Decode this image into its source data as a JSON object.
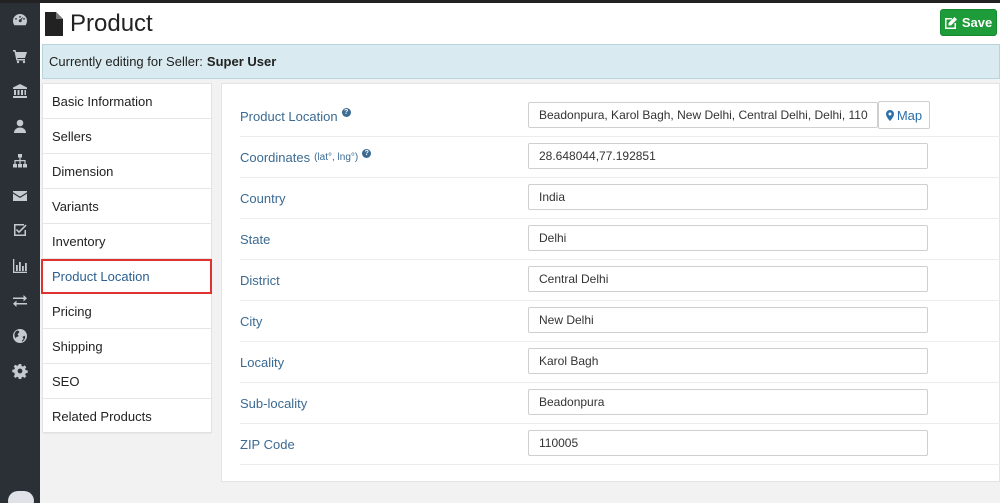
{
  "header": {
    "title": "Product",
    "save_label": "Save"
  },
  "seller_bar": {
    "prefix": "Currently editing for Seller:",
    "seller_name": "Super User"
  },
  "sidebar_icons": [
    "dashboard-icon",
    "cart-icon",
    "bank-icon",
    "user-icon",
    "sitemap-icon",
    "envelope-icon",
    "checkbox-icon",
    "bar-chart-icon",
    "exchange-icon",
    "globe-icon",
    "cog-icon"
  ],
  "tabs": [
    {
      "label": "Basic Information"
    },
    {
      "label": "Sellers"
    },
    {
      "label": "Dimension"
    },
    {
      "label": "Variants"
    },
    {
      "label": "Inventory"
    },
    {
      "label": "Product Location",
      "active": true
    },
    {
      "label": "Pricing"
    },
    {
      "label": "Shipping"
    },
    {
      "label": "SEO"
    },
    {
      "label": "Related Products"
    }
  ],
  "form": {
    "product_location": {
      "label": "Product Location",
      "value": "Beadonpura, Karol Bagh, New Delhi, Central Delhi, Delhi, 110",
      "map_label": "Map"
    },
    "coordinates": {
      "label": "Coordinates",
      "sub": "(lat°, lng°)",
      "value": "28.648044,77.192851"
    },
    "country": {
      "label": "Country",
      "value": "India"
    },
    "state": {
      "label": "State",
      "value": "Delhi"
    },
    "district": {
      "label": "District",
      "value": "Central Delhi"
    },
    "city": {
      "label": "City",
      "value": "New Delhi"
    },
    "locality": {
      "label": "Locality",
      "value": "Karol Bagh"
    },
    "sub_locality": {
      "label": "Sub-locality",
      "value": "Beadonpura"
    },
    "zip": {
      "label": "ZIP Code",
      "value": "110005"
    }
  },
  "colors": {
    "sidebar_bg": "#2b3036",
    "save_green": "#1e9c3a",
    "label_blue": "#3b6a92",
    "active_outline": "#e0322f",
    "seller_bar_bg": "#d9ebf0"
  }
}
